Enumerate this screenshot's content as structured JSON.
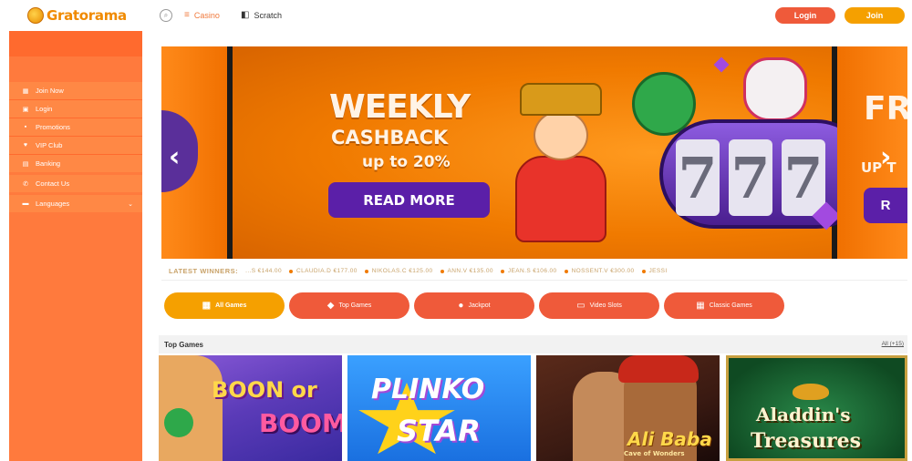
{
  "header": {
    "logo_text": "Gratorama",
    "nav": [
      {
        "label": "Casino",
        "icon": "grid-icon"
      },
      {
        "label": "Scratch",
        "icon": "scratch-icon"
      }
    ],
    "login_label": "Login",
    "join_label": "Join"
  },
  "sidebar": {
    "items": [
      {
        "label": "Join Now",
        "icon": "grid-icon"
      },
      {
        "label": "Login",
        "icon": "login-icon"
      },
      {
        "label": "Promotions",
        "icon": "gift-icon"
      },
      {
        "label": "VIP Club",
        "icon": "heart-icon"
      },
      {
        "label": "Banking",
        "icon": "bank-icon"
      }
    ],
    "contact_label": "Contact Us",
    "language_label": "Languages"
  },
  "banner": {
    "title": "WEEKLY",
    "subtitle": "CASHBACK",
    "subtitle2": "up to 20%",
    "cta": "READ MORE",
    "next_slide_title": "FR",
    "next_slide_sub": "UP T",
    "next_slide_cta": "R",
    "reel_symbols": [
      "7",
      "7",
      "7"
    ]
  },
  "ticker": {
    "label": "LATEST WINNERS:",
    "items": [
      "...S €144.00",
      "CLAUDIA.D €177.00",
      "NIKOLAS.C €125.00",
      "ANN.V €135.00",
      "JEAN.S €106.00",
      "NOSSENT.V €300.00",
      "JESSI"
    ]
  },
  "categories": [
    {
      "label": "All Games",
      "icon": "grid-icon",
      "active": true
    },
    {
      "label": "Top Games",
      "icon": "diamond-icon",
      "active": false
    },
    {
      "label": "Jackpot",
      "icon": "coin-icon",
      "active": false
    },
    {
      "label": "Video Slots",
      "icon": "slots-icon",
      "active": false
    },
    {
      "label": "Classic Games",
      "icon": "grid-icon",
      "active": false
    }
  ],
  "top_games": {
    "title": "Top Games",
    "all_link": "All (+15)",
    "games": [
      {
        "title_line1": "BOON or",
        "title_line2": "BOOM"
      },
      {
        "title_line1": "PLINKO",
        "title_line2": "STAR"
      },
      {
        "title_line1": "Ali Baba",
        "title_line2": "Cave of Wonders"
      },
      {
        "title_line1": "Aladdin's",
        "title_line2": "Treasures"
      }
    ]
  },
  "colors": {
    "brand_orange": "#ff7a3d",
    "login_red": "#ef5a3a",
    "join_gold": "#f5a000",
    "cta_purple": "#5b1fa8"
  }
}
